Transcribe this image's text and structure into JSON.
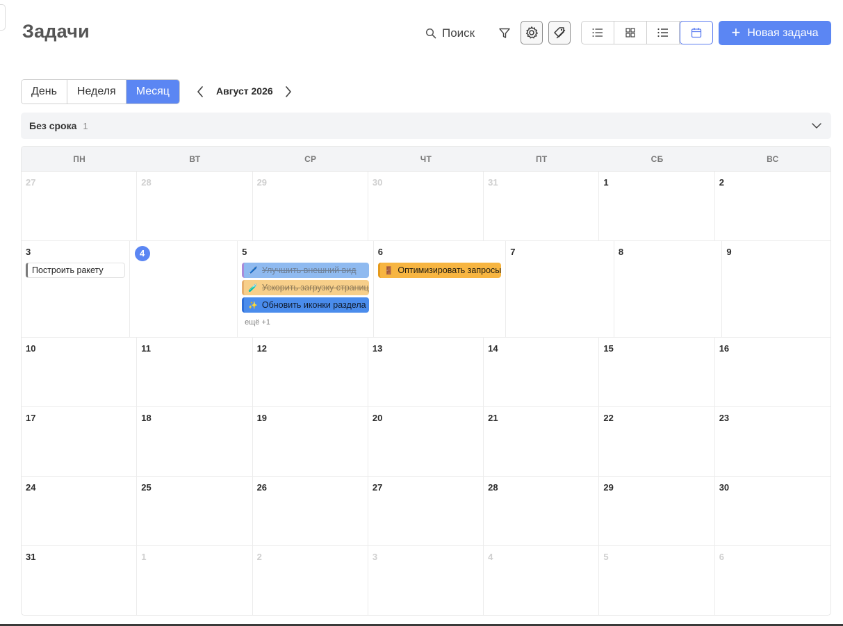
{
  "header": {
    "title": "Задачи",
    "search_label": "Поиск",
    "new_task_label": "Новая задача"
  },
  "toolbar": {
    "range_buttons": [
      "День",
      "Неделя",
      "Месяц"
    ],
    "active_range": "Месяц",
    "month_label": "Август 2026"
  },
  "nodate": {
    "label": "Без срока",
    "count": "1"
  },
  "calendar": {
    "weekdays": [
      "ПН",
      "ВТ",
      "СР",
      "ЧТ",
      "ПТ",
      "СБ",
      "ВС"
    ],
    "weeks": [
      [
        "27",
        "28",
        "29",
        "30",
        "31",
        "1",
        "2"
      ],
      [
        "3",
        "4",
        "5",
        "6",
        "7",
        "8",
        "9"
      ],
      [
        "10",
        "11",
        "12",
        "13",
        "14",
        "15",
        "16"
      ],
      [
        "17",
        "18",
        "19",
        "20",
        "21",
        "22",
        "23"
      ],
      [
        "24",
        "25",
        "26",
        "27",
        "28",
        "29",
        "30"
      ],
      [
        "31",
        "1",
        "2",
        "3",
        "4",
        "5",
        "6"
      ]
    ],
    "today": "4",
    "tasks": {
      "mon3": {
        "title": "Построить ракету"
      },
      "wed5_1": {
        "title": "Улучшить внешний вид",
        "emoji": "🖊️",
        "color": "#8fbaf0",
        "done": true
      },
      "wed5_2": {
        "title": "Ускорить загрузку страниц",
        "emoji": "🧪",
        "color": "#f7cf8a",
        "done": true
      },
      "wed5_3": {
        "title": "Обновить иконки раздела",
        "emoji": "✨",
        "color": "#4a8cec",
        "done": false
      },
      "thu6": {
        "title": "Оптимизировать запросы",
        "emoji": "🚪",
        "color": "#f7b541",
        "done": false
      }
    },
    "more_label": "ещё +1"
  },
  "colors": {
    "accent": "#5b86f3",
    "task_blue_light": "#8fbaf0",
    "task_orange_light": "#f7cf8a",
    "task_blue": "#4a8cec",
    "task_orange": "#f7b541"
  }
}
